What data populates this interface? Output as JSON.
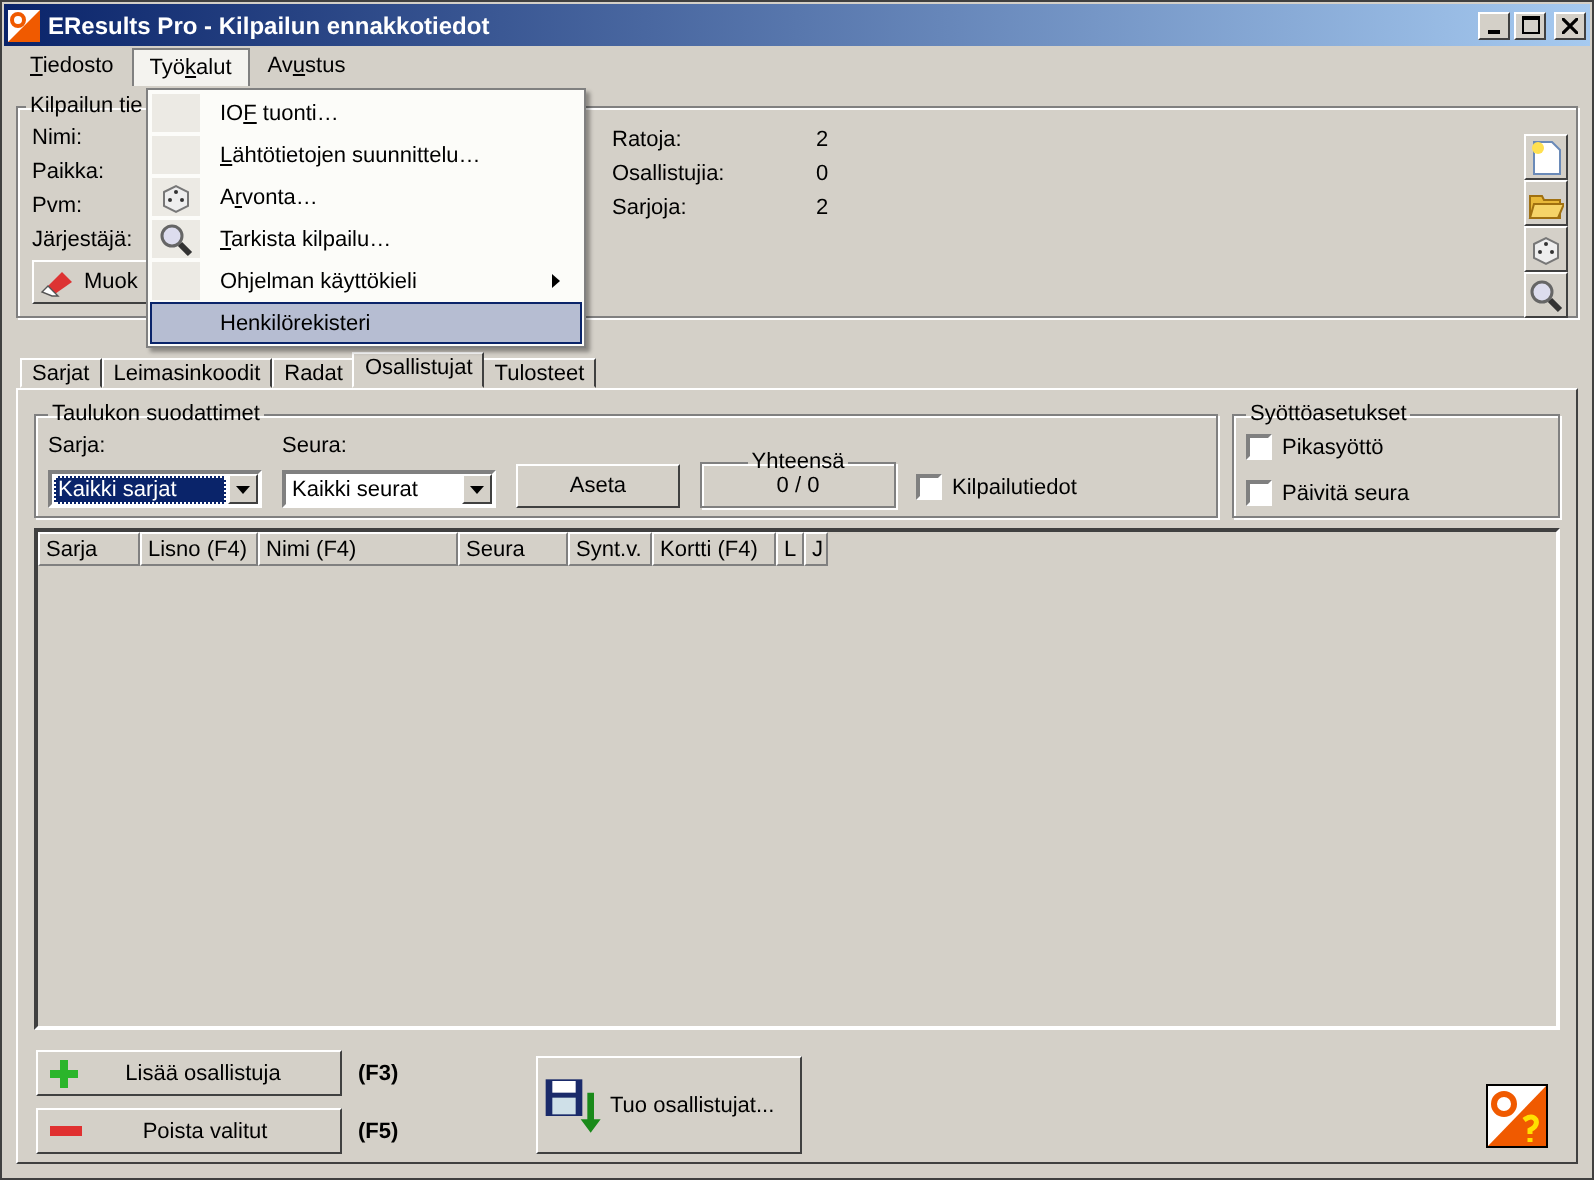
{
  "window": {
    "title": "EResults Pro - Kilpailun ennakkotiedot"
  },
  "menubar": [
    {
      "label": "Tiedosto",
      "selected": false
    },
    {
      "label": "Työkalut",
      "selected": true
    },
    {
      "label": "Avustus",
      "selected": false
    }
  ],
  "menu": [
    {
      "label": "IOF tuonti…",
      "submenu": false,
      "selected": false
    },
    {
      "label": "Lähtötietojen suunnittelu…",
      "submenu": false,
      "selected": false
    },
    {
      "label": "Arvonta…",
      "submenu": false,
      "selected": false
    },
    {
      "label": "Tarkista kilpailu…",
      "submenu": false,
      "selected": false
    },
    {
      "label": "Ohjelman käyttökieli",
      "submenu": true,
      "selected": false
    },
    {
      "label": "Henkilörekisteri",
      "submenu": false,
      "selected": true
    }
  ],
  "competition": {
    "group_label": "Kilpailun tie",
    "fields": [
      "Nimi:",
      "Paikka:",
      "Pvm:",
      "Järjestäjä:"
    ],
    "edit_button": "Muok",
    "stats": [
      {
        "label": "Ratoja:",
        "value": "2"
      },
      {
        "label": "Osallistujia:",
        "value": "0"
      },
      {
        "label": "Sarjoja:",
        "value": "2"
      }
    ]
  },
  "tabs": [
    {
      "label": "Sarjat",
      "selected": false
    },
    {
      "label": "Leimasinkoodit",
      "selected": false
    },
    {
      "label": "Radat",
      "selected": false
    },
    {
      "label": "Osallistujat",
      "selected": true
    },
    {
      "label": "Tulosteet",
      "selected": false
    }
  ],
  "filters": {
    "group_label": "Taulukon suodattimet",
    "sarja": {
      "label": "Sarja:",
      "value": "Kaikki sarjat",
      "focused": true
    },
    "seura": {
      "label": "Seura:",
      "value": "Kaikki seurat",
      "focused": false
    },
    "apply_button": "Aseta",
    "total": {
      "label": "Yhteensä",
      "value": "0 / 0"
    },
    "checkbox": {
      "label": "Kilpailutiedot",
      "checked": false
    }
  },
  "input_settings": {
    "group_label": "Syöttöasetukset",
    "options": [
      {
        "label": "Pikasyöttö",
        "checked": false
      },
      {
        "label": "Päivitä seura",
        "checked": false
      }
    ]
  },
  "table": {
    "columns": [
      "Sarja",
      "Lisno (F4)",
      "Nimi (F4)",
      "Seura",
      "Synt.v.",
      "Kortti (F4)",
      "L",
      "J"
    ]
  },
  "actions": [
    {
      "label": "Lisää osallistuja",
      "shortcut": "(F3)",
      "kind": "add"
    },
    {
      "label": "Poista valitut",
      "shortcut": "(F5)",
      "kind": "remove"
    }
  ],
  "import_button": "Tuo osallistujat..."
}
